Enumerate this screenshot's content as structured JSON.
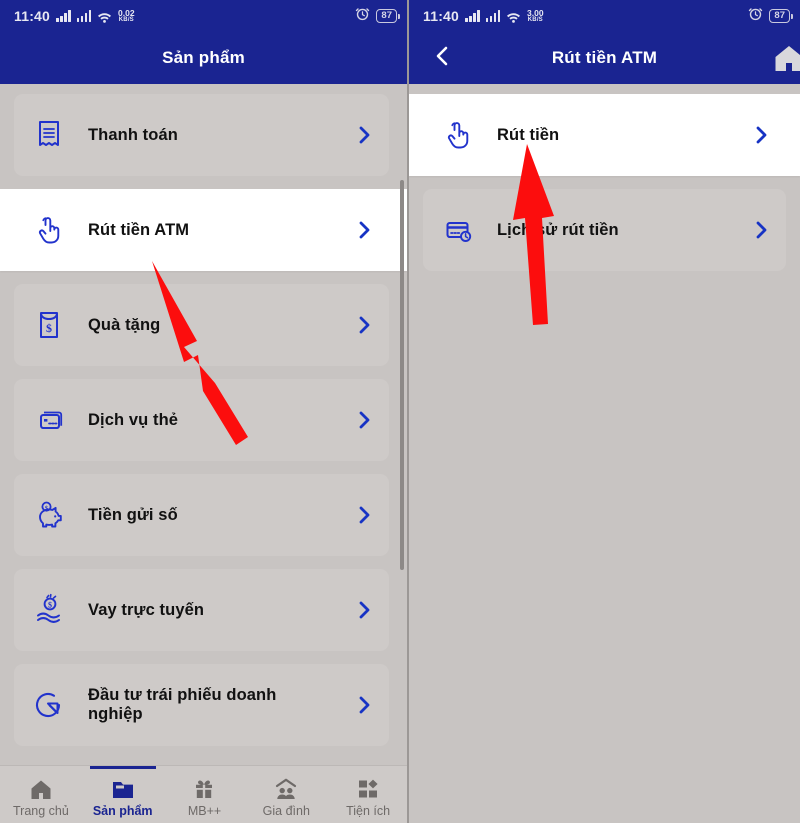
{
  "status_bar": {
    "left_screen": {
      "time": "11:40",
      "net_speed_value": "0.02",
      "net_speed_unit": "KB/S",
      "battery": "87"
    },
    "right_screen": {
      "time": "11:40",
      "net_speed_value": "3.00",
      "net_speed_unit": "KB/S",
      "battery": "87"
    }
  },
  "left_screen": {
    "header": {
      "title": "Sản phẩm"
    },
    "items": [
      {
        "label": "Thanh toán",
        "icon": "receipt-icon",
        "active": false
      },
      {
        "label": "Rút tiền ATM",
        "icon": "tap-hand-icon",
        "active": true
      },
      {
        "label": "Quà tặng",
        "icon": "gift-envelope-icon",
        "active": false
      },
      {
        "label": "Dịch vụ thẻ",
        "icon": "cards-icon",
        "active": false
      },
      {
        "label": "Tiền gửi số",
        "icon": "piggy-bank-icon",
        "active": false
      },
      {
        "label": "Vay trực tuyến",
        "icon": "loan-hand-icon",
        "active": false
      },
      {
        "label": "Đầu tư trái phiếu doanh nghiệp",
        "icon": "bond-invest-icon",
        "active": false
      }
    ],
    "bottom_nav": [
      {
        "label": "Trang chủ",
        "icon": "home-icon",
        "active": false
      },
      {
        "label": "Sản phẩm",
        "icon": "folder-icon",
        "active": true
      },
      {
        "label": "MB++",
        "icon": "gift-icon",
        "active": false
      },
      {
        "label": "Gia đình",
        "icon": "family-icon",
        "active": false
      },
      {
        "label": "Tiện ích",
        "icon": "grid-icon",
        "active": false
      }
    ]
  },
  "right_screen": {
    "header": {
      "title": "Rút tiền ATM",
      "back_icon": "chevron-left-icon",
      "home_icon": "home-icon"
    },
    "items": [
      {
        "label": "Rút tiền",
        "icon": "tap-hand-icon",
        "active": true
      },
      {
        "label": "Lịch sử rút tiền",
        "icon": "card-clock-icon",
        "active": false
      }
    ]
  },
  "annotations": {
    "arrow_color": "#fc0d0d",
    "arrows": [
      {
        "name": "arrow-pointing-rut-tien-atm",
        "target": "Rút tiền ATM"
      },
      {
        "name": "arrow-pointing-rut-tien",
        "target": "Rút tiền"
      }
    ]
  },
  "theme": {
    "header_blue": "#1a2491",
    "icon_blue": "#2233cc",
    "page_bg": "#c8c4c2",
    "card_bg": "#cecac8",
    "active_card_bg": "#ffffff"
  }
}
